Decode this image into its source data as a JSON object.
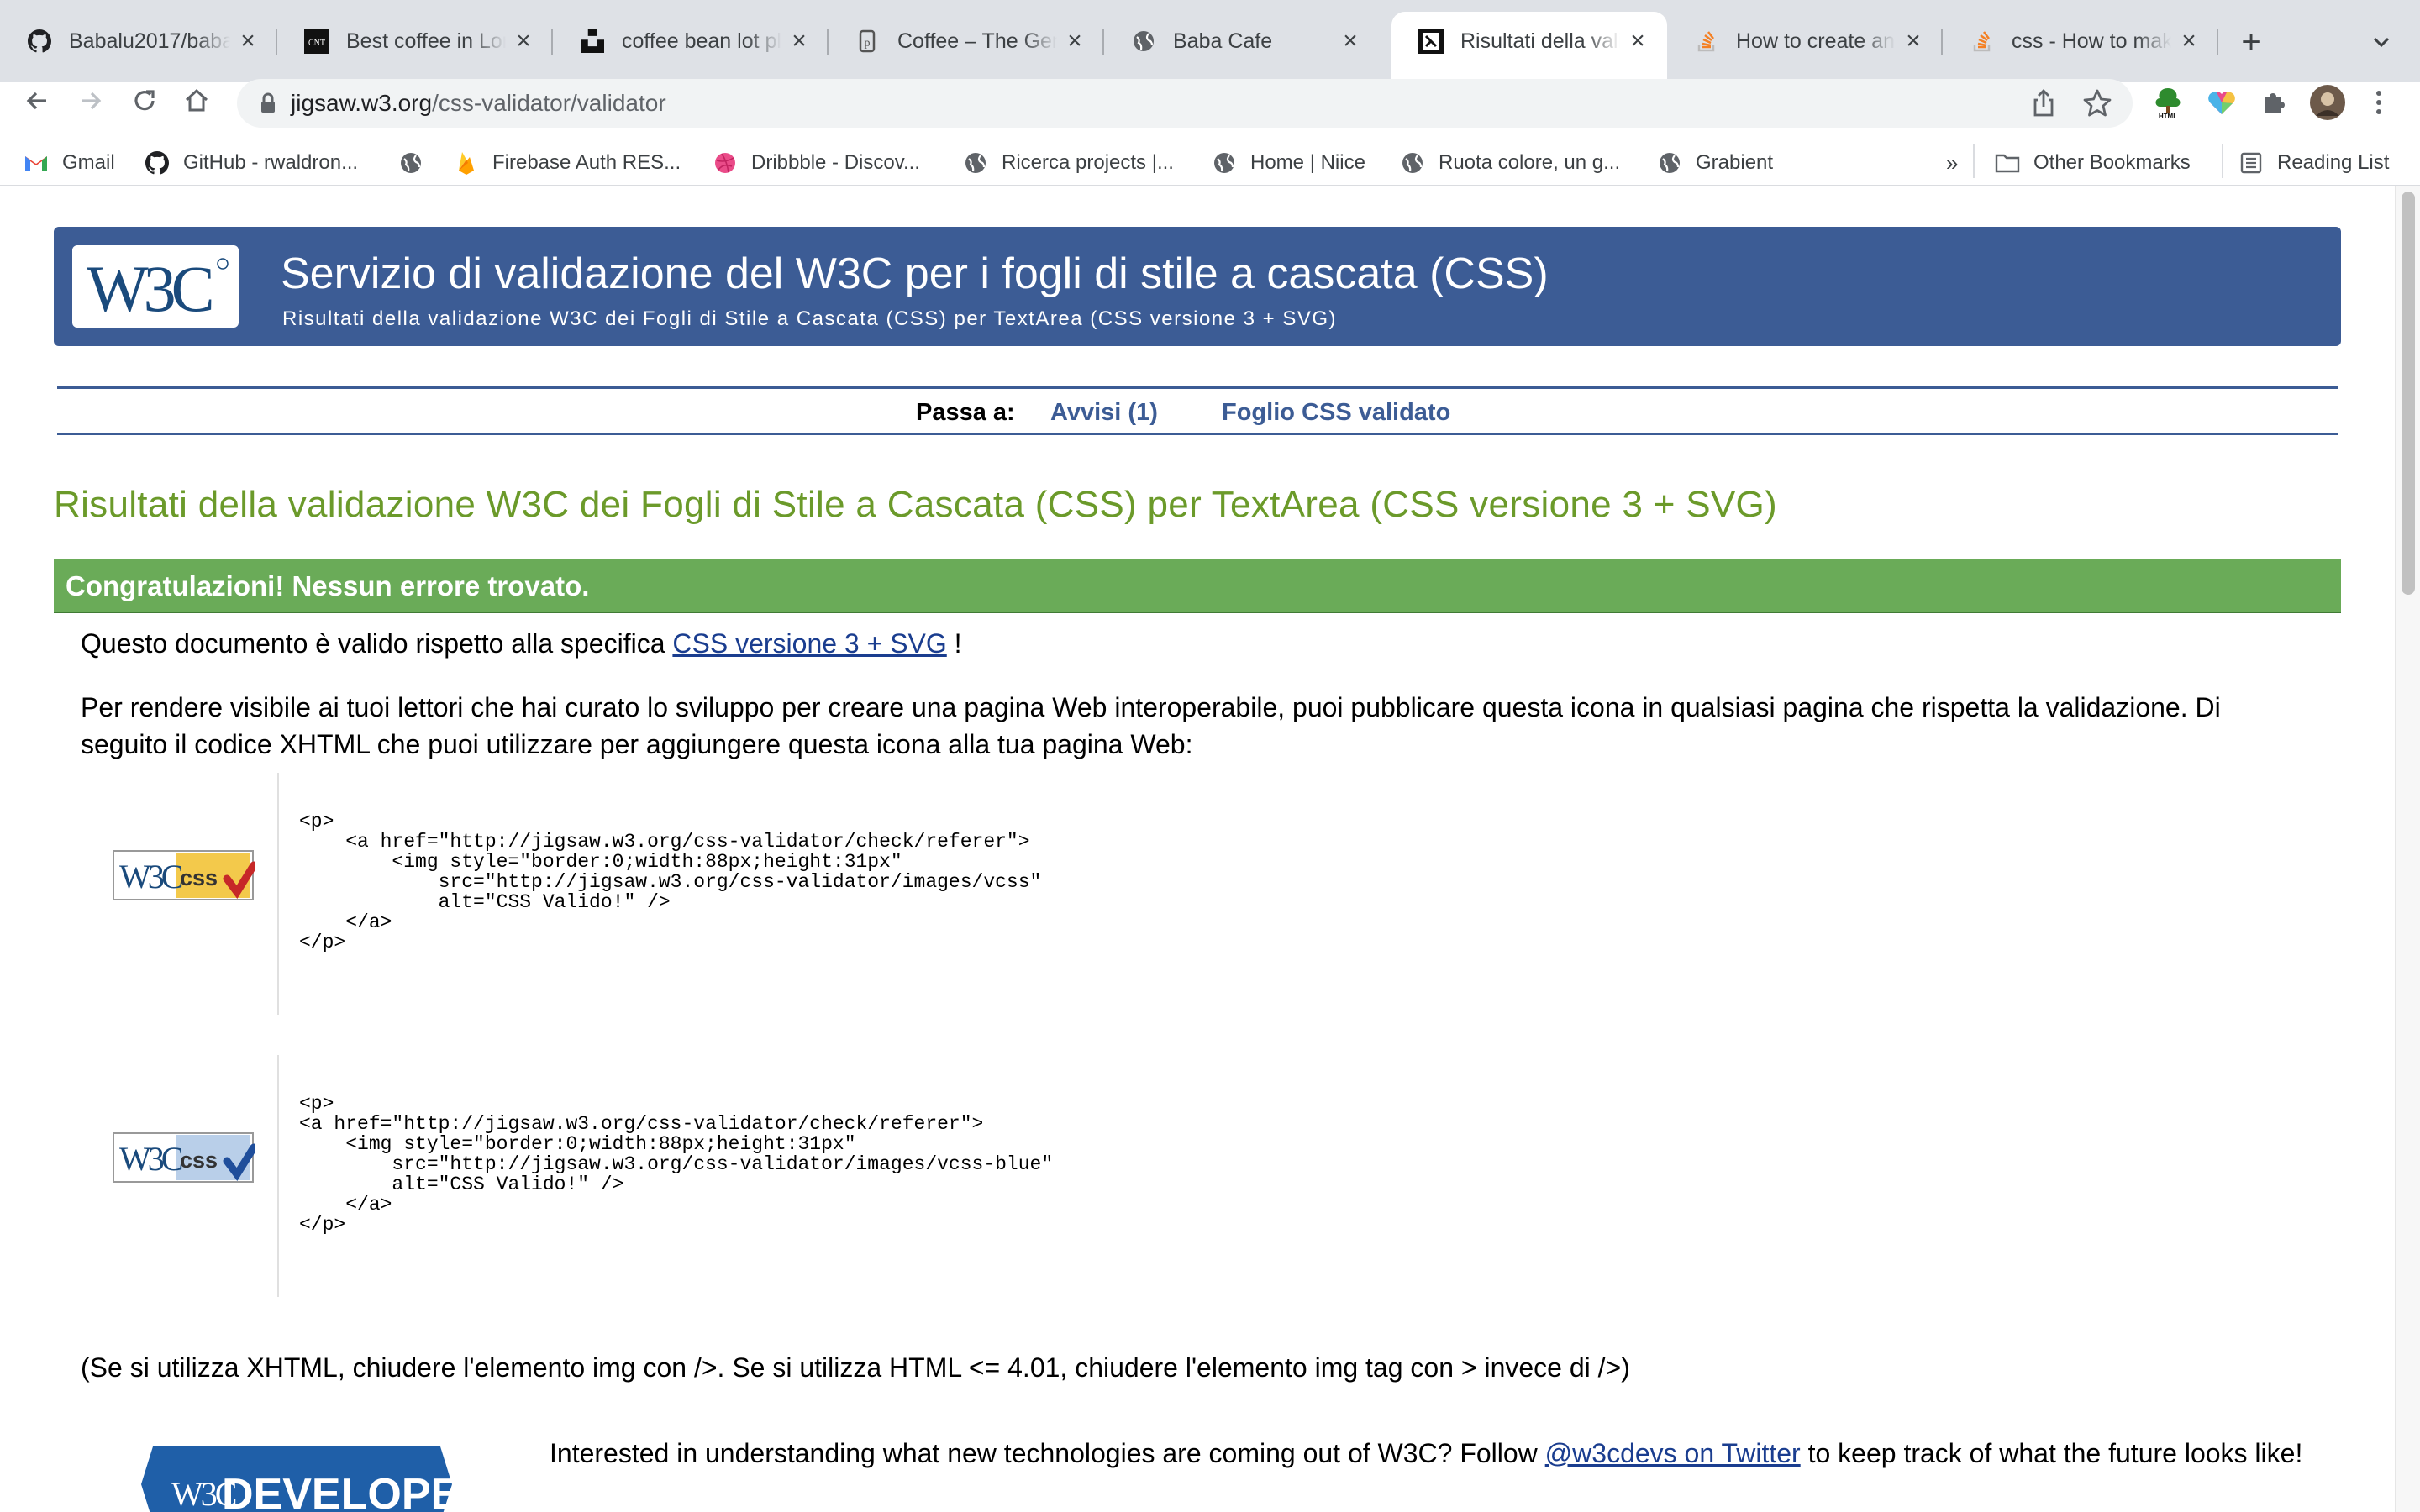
{
  "browser": {
    "tabs": [
      {
        "title": "Babalu2017/baba",
        "icon": "github-icon",
        "active": false
      },
      {
        "title": "Best coffee in Lon",
        "icon": "cnt-icon",
        "active": false
      },
      {
        "title": "coffee bean lot pl",
        "icon": "unsplash-icon",
        "active": false
      },
      {
        "title": "Coffee – The Gen",
        "icon": "coffee-icon",
        "active": false
      },
      {
        "title": "Baba Cafe",
        "icon": "globe-icon",
        "active": false
      },
      {
        "title": "Risultati della vali",
        "icon": "w3c-icon",
        "active": true
      },
      {
        "title": "How to create an",
        "icon": "stackoverflow-icon",
        "active": false
      },
      {
        "title": "css - How to mak",
        "icon": "stackoverflow-icon",
        "active": false
      }
    ],
    "url_host": "jigsaw.w3.org",
    "url_path": "/css-validator/validator",
    "bookmarks": [
      {
        "label": "Gmail",
        "icon": "gmail-icon"
      },
      {
        "label": "GitHub - rwaldron...",
        "icon": "github-icon"
      },
      {
        "label": "",
        "icon": "globe-icon"
      },
      {
        "label": "Firebase Auth RES...",
        "icon": "firebase-icon"
      },
      {
        "label": "Dribbble - Discov...",
        "icon": "dribbble-icon"
      },
      {
        "label": "Ricerca projects |...",
        "icon": "globe-icon"
      },
      {
        "label": "Home | Niice",
        "icon": "globe-icon"
      },
      {
        "label": "Ruota colore, un g...",
        "icon": "globe-icon"
      },
      {
        "label": "Grabient",
        "icon": "globe-icon"
      }
    ],
    "bookmarks_overflow": "»",
    "other_bookmarks": "Other Bookmarks",
    "reading_list": "Reading List"
  },
  "page": {
    "banner": {
      "logo_text": "W3C",
      "title": "Servizio di validazione del W3C per i fogli di stile a cascata (CSS)",
      "subtitle": "Risultati della validazione W3C dei Fogli di Stile a Cascata (CSS) per TextArea (CSS versione 3 + SVG)"
    },
    "jump": {
      "label": "Passa a:",
      "warnings": "Avvisi (1)",
      "validated_sheet": "Foglio CSS validato"
    },
    "results_heading": "Risultati della validazione W3C dei Fogli di Stile a Cascata (CSS) per TextArea (CSS versione 3 + SVG)",
    "success": "Congratulazioni! Nessun errore trovato.",
    "valid_prefix": "Questo documento è valido rispetto alla specifica ",
    "valid_link": "CSS versione 3 + SVG",
    "valid_suffix": " !",
    "icon_para": "Per rendere visibile ai tuoi lettori che hai curato lo sviluppo per creare una pagina Web interoperabile, puoi pubblicare questa icona in qualsiasi pagina che rispetta la validazione. Di seguito il codice XHTML che puoi utilizzare per aggiungere questa icona alla tua pagina Web:",
    "code_gold": "<p>\n    <a href=\"http://jigsaw.w3.org/css-validator/check/referer\">\n        <img style=\"border:0;width:88px;height:31px\"\n            src=\"http://jigsaw.w3.org/css-validator/images/vcss\"\n            alt=\"CSS Valido!\" />\n    </a>\n</p>",
    "code_blue": "<p>\n<a href=\"http://jigsaw.w3.org/css-validator/check/referer\">\n    <img style=\"border:0;width:88px;height:31px\"\n        src=\"http://jigsaw.w3.org/css-validator/images/vcss-blue\"\n        alt=\"CSS Valido!\" />\n    </a>\n</p>",
    "badge_left": "W3C",
    "badge_right": "css",
    "xhtml_note": "(Se si utilizza XHTML, chiudere l'elemento img con />. Se si utilizza HTML <= 4.01, chiudere l'elemento img tag con > invece di />)",
    "devs_logo_w3c": "W3C",
    "devs_logo_text": "DEVELOPERS",
    "twitter_prefix": "Interested in understanding what new technologies are coming out of W3C? Follow ",
    "twitter_link": "@w3cdevs on Twitter",
    "twitter_suffix": " to keep track of what the future looks like!"
  },
  "colors": {
    "banner": "#3c5c95",
    "heading_green": "#6b9a2a",
    "success_green": "#6aab58",
    "link_blue": "#1a3d8f"
  }
}
